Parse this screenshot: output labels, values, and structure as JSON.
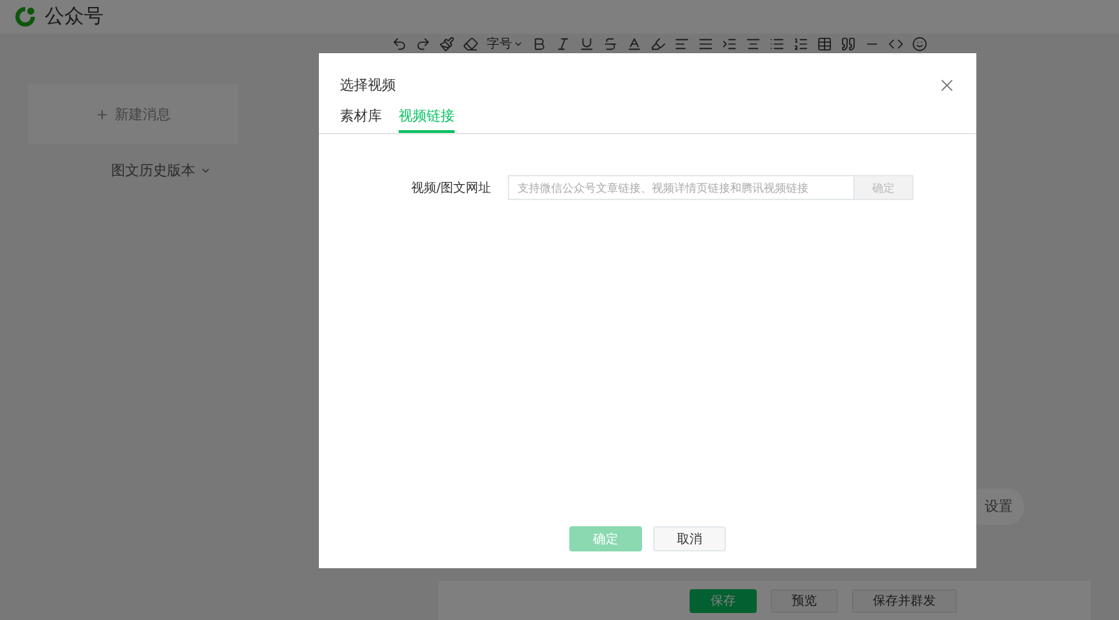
{
  "app": {
    "name": "公众号"
  },
  "sidebar": {
    "new_message": "新建消息",
    "history": "图文历史版本"
  },
  "toolbar": {
    "font_size": "字号"
  },
  "settings_button": "设置",
  "footer_buttons": [
    {
      "label": "保存",
      "kind": "primary"
    },
    {
      "label": "预览",
      "kind": "default"
    },
    {
      "label": "保存并群发",
      "kind": "default"
    }
  ],
  "dialog": {
    "title": "选择视频",
    "tabs": [
      {
        "label": "素材库",
        "selected": false
      },
      {
        "label": "视频链接",
        "selected": true
      }
    ],
    "url_field": {
      "label": "视频/图文网址",
      "placeholder": "支持微信公众号文章链接、视频详情页链接和腾讯视频链接",
      "button": {
        "label": "确定",
        "disabled": true
      }
    },
    "buttons": [
      {
        "label": "确定",
        "kind": "primary",
        "disabled": true
      },
      {
        "label": "取消",
        "kind": "default",
        "disabled": false
      }
    ]
  }
}
